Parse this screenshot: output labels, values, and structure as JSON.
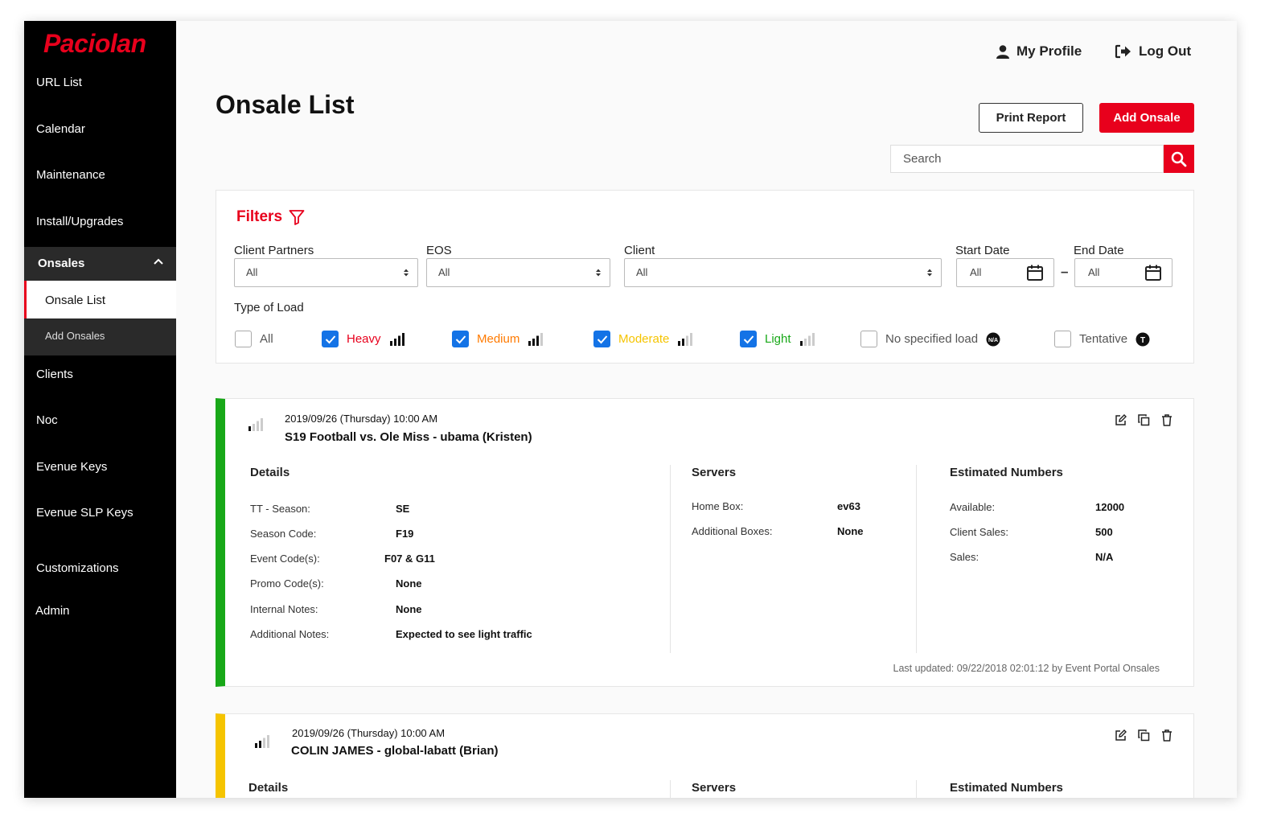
{
  "brand": {
    "logo": "Paciolan",
    "accent": "#e8001c"
  },
  "sidebar": {
    "items": [
      "URL List",
      "Calendar",
      "Maintenance",
      "Install/Upgrades"
    ],
    "group": {
      "label": "Onsales",
      "sub": [
        "Onsale List",
        "Add Onsales"
      ]
    },
    "items_after": [
      "Clients",
      "Noc",
      "Evenue Keys",
      "Evenue SLP Keys",
      "Customizations",
      "Admin"
    ]
  },
  "header": {
    "profile": "My Profile",
    "logout": "Log Out"
  },
  "page": {
    "title": "Onsale List",
    "print": "Print Report",
    "add": "Add Onsale",
    "search_placeholder": "Search"
  },
  "filters": {
    "title": "Filters",
    "client_partners": {
      "label": "Client Partners",
      "value": "All"
    },
    "eos": {
      "label": "EOS",
      "value": "All"
    },
    "client": {
      "label": "Client",
      "value": "All"
    },
    "start_date": {
      "label": "Start Date",
      "value": "All"
    },
    "end_date": {
      "label": "End Date",
      "value": "All"
    },
    "type_label": "Type of Load",
    "types": [
      {
        "label": "All",
        "checked": false,
        "color": "#333333",
        "icon": "none"
      },
      {
        "label": "Heavy",
        "checked": true,
        "color": "#e8001c",
        "icon": "signal-4"
      },
      {
        "label": "Medium",
        "checked": true,
        "color": "#ff7a00",
        "icon": "signal-3"
      },
      {
        "label": "Moderate",
        "checked": true,
        "color": "#f5c400",
        "icon": "signal-2"
      },
      {
        "label": "Light",
        "checked": true,
        "color": "#18a818",
        "icon": "signal-1"
      },
      {
        "label": "No specified load",
        "checked": false,
        "color": "#555555",
        "icon": "na-badge",
        "badge": "N/A"
      },
      {
        "label": "Tentative",
        "checked": false,
        "color": "#555555",
        "icon": "t-badge",
        "badge": "T"
      }
    ]
  },
  "onsales": [
    {
      "accent": "#18a818",
      "load_icon": "signal-1",
      "date": "2019/09/26 (Thursday) 10:00 AM",
      "name": "S19 Football vs. Ole Miss - ubama (Kristen)",
      "details_title": "Details",
      "details": [
        {
          "label": "TT - Season:",
          "value": "SE"
        },
        {
          "label": "Season Code:",
          "value": "F19"
        },
        {
          "label": "Event Code(s):",
          "value": "F07 & G11"
        },
        {
          "label": "Promo Code(s):",
          "value": "None"
        },
        {
          "label": "Internal Notes:",
          "value": "None"
        },
        {
          "label": "Additional Notes:",
          "value": "Expected to see light traffic"
        }
      ],
      "servers_title": "Servers",
      "servers": [
        {
          "label": "Home Box:",
          "value": "ev63"
        },
        {
          "label": "Additional Boxes:",
          "value": "None"
        }
      ],
      "numbers_title": "Estimated Numbers",
      "numbers": [
        {
          "label": "Available:",
          "value": "12000"
        },
        {
          "label": "Client Sales:",
          "value": "500"
        },
        {
          "label": "Sales:",
          "value": "N/A"
        }
      ],
      "updated": "Last updated: 09/22/2018 02:01:12 by Event Portal Onsales"
    },
    {
      "accent": "#f5c400",
      "load_icon": "signal-2",
      "date": "2019/09/26 (Thursday) 10:00 AM",
      "name": "COLIN JAMES - global-labatt (Brian)",
      "details_title": "Details",
      "servers_title": "Servers",
      "numbers_title": "Estimated Numbers"
    }
  ]
}
